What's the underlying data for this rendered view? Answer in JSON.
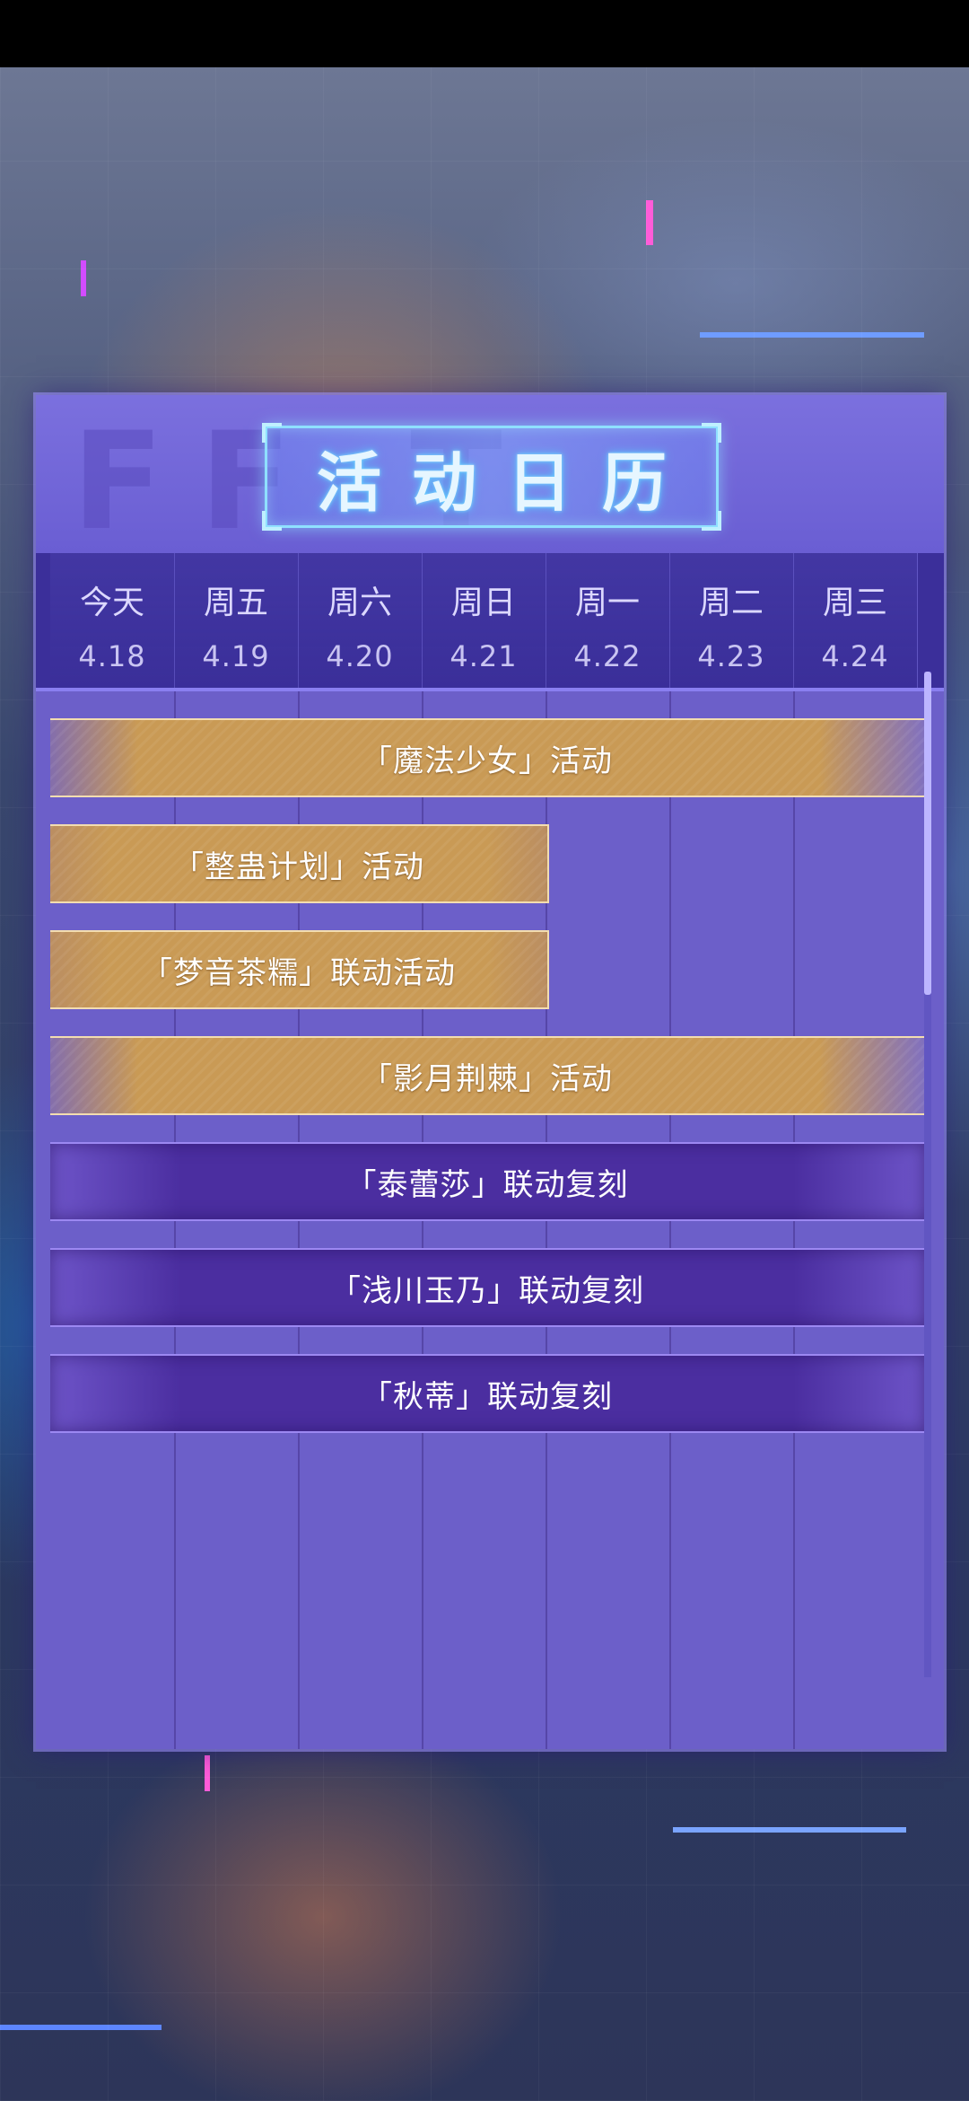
{
  "header": {
    "title": "活动日历"
  },
  "days": [
    {
      "name": "今天",
      "date": "4.18"
    },
    {
      "name": "周五",
      "date": "4.19"
    },
    {
      "name": "周六",
      "date": "4.20"
    },
    {
      "name": "周日",
      "date": "4.21"
    },
    {
      "name": "周一",
      "date": "4.22"
    },
    {
      "name": "周二",
      "date": "4.23"
    },
    {
      "name": "周三",
      "date": "4.24"
    }
  ],
  "events": [
    {
      "label": "「魔法少女」活动",
      "style": "gold",
      "start_day": "4.18",
      "end_day": "4.24"
    },
    {
      "label": "「整蛊计划」活动",
      "style": "gold",
      "start_day": "4.18",
      "end_day": "4.21"
    },
    {
      "label": "「梦音茶糯」联动活动",
      "style": "gold",
      "start_day": "4.18",
      "end_day": "4.21"
    },
    {
      "label": "「影月荆棘」活动",
      "style": "gold",
      "start_day": "4.18",
      "end_day": "4.24"
    },
    {
      "label": "「泰蕾莎」联动复刻",
      "style": "purple",
      "start_day": "4.18",
      "end_day": "4.24"
    },
    {
      "label": "「浅川玉乃」联动复刻",
      "style": "purple",
      "start_day": "4.18",
      "end_day": "4.24"
    },
    {
      "label": "「秋蒂」联动复刻",
      "style": "purple",
      "start_day": "4.18",
      "end_day": "4.24"
    }
  ]
}
